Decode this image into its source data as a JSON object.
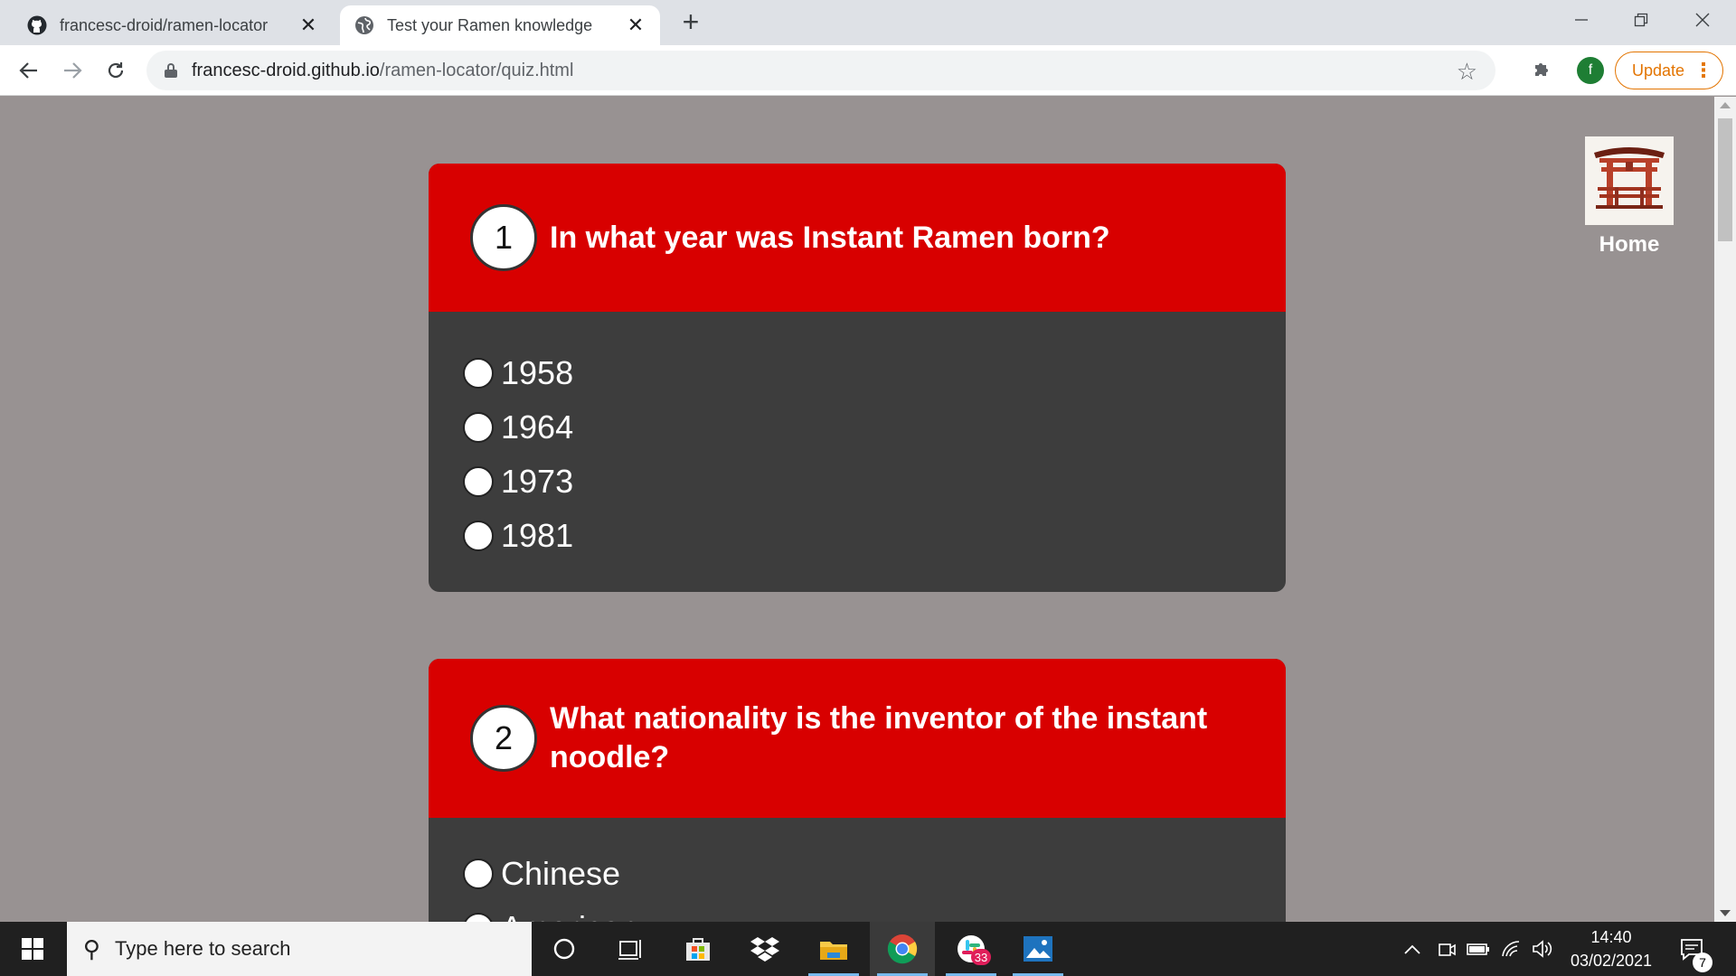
{
  "browser": {
    "tabs": [
      {
        "title": "francesc-droid/ramen-locator",
        "active": false
      },
      {
        "title": "Test your Ramen knowledge",
        "active": true
      }
    ],
    "new_tab_label": "+",
    "url_host": "francesc-droid.github.io",
    "url_path": "/ramen-locator/quiz.html",
    "profile_initial": "f",
    "update_label": "Update",
    "accent_update": "#e37400"
  },
  "page": {
    "home_label": "Home",
    "questions": [
      {
        "number": "1",
        "text": "In what year was Instant Ramen born?",
        "options": [
          "1958",
          "1964",
          "1973",
          "1981"
        ]
      },
      {
        "number": "2",
        "text": "What nationality is the inventor of the instant noodle?",
        "options": [
          "Chinese",
          "American"
        ]
      }
    ],
    "colors": {
      "background": "#989292",
      "question_header": "#d80000",
      "question_body": "#3d3d3d"
    }
  },
  "taskbar": {
    "search_placeholder": "Type here to search",
    "time": "14:40",
    "date": "03/02/2021",
    "notification_count": "7",
    "slack_badge": "33"
  }
}
